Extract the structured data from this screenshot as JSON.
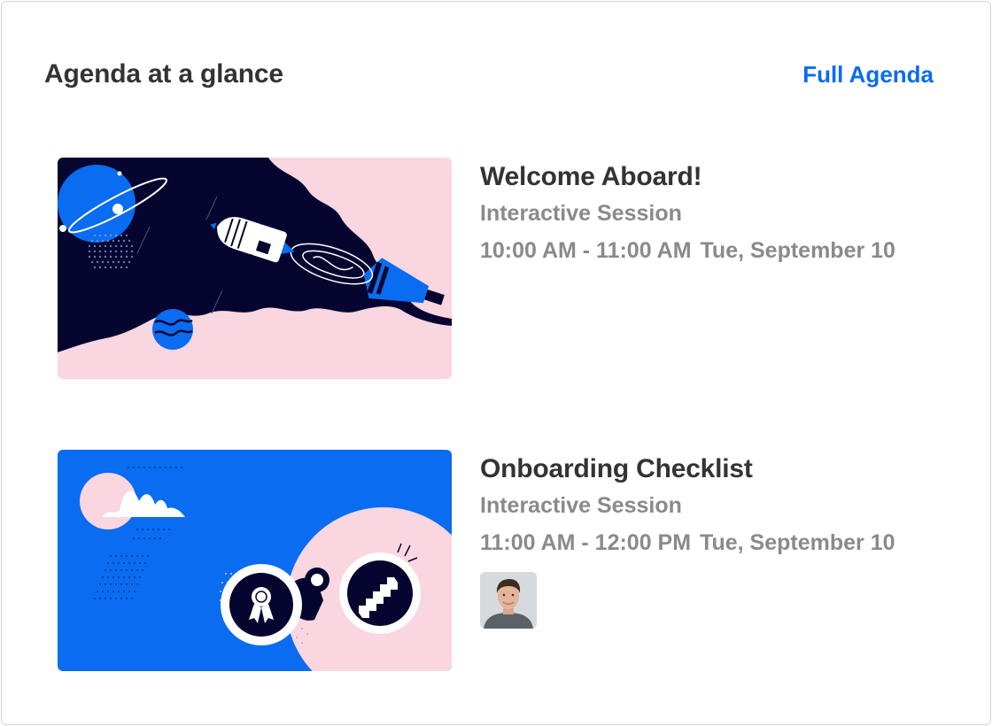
{
  "header": {
    "title": "Agenda at a glance",
    "full_agenda_link": "Full Agenda"
  },
  "colors": {
    "accent": "#0a6cf0",
    "title_text": "#333333",
    "meta_text": "#8a8a8a",
    "thumb_navy": "#050530",
    "thumb_pink": "#f9d6e0",
    "thumb_blue": "#0a6cf0"
  },
  "sessions": [
    {
      "title": "Welcome Aboard!",
      "type": "Interactive Session",
      "time": "10:00 AM - 11:00 AM",
      "date": "Tue, September 10",
      "thumbnail": "space-rocket-illustration"
    },
    {
      "title": "Onboarding Checklist",
      "type": "Interactive Session",
      "time": "11:00 AM - 12:00 PM",
      "date": "Tue, September 10",
      "thumbnail": "binoculars-illustration",
      "speaker_avatar": "speaker-avatar"
    }
  ]
}
